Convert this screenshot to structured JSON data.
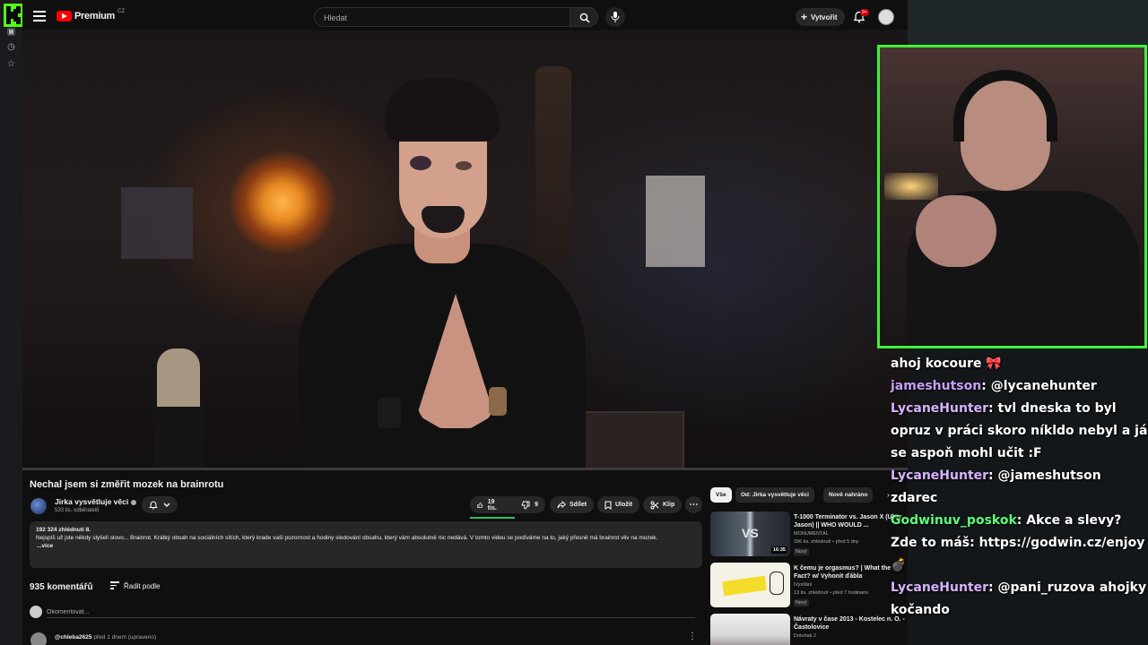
{
  "yt": {
    "logo_text": "Premium",
    "logo_region": "CZ",
    "search_placeholder": "Hledat",
    "create_label": "Vytvořit",
    "notifications_badge": "9+"
  },
  "video": {
    "title": "Nechal jsem si změřit mozek na brainrotu",
    "channel_name": "Jirka vysvětluje věci",
    "channel_subs": "533 tis. odběratelů",
    "likes": "19 tis.",
    "dislikes": "9",
    "share_label": "Sdílet",
    "save_label": "Uložit",
    "clip_label": "Klip",
    "description_stats": "192 324 zhlédnutí  8.",
    "description_text": "Nejspíš už jste někdy slyšeli slovo... Brainrot. Krátký obsah na sociálních sítích, který krade vaši pozornost a hodiny sledování obsahu, který vám absolutně nic nedává. V tomto videu se podíváme na to, jaký přesně má brainrot vliv na mozek.",
    "description_more": "...více"
  },
  "comments": {
    "count": "935 komentářů",
    "sort_label": "Řadit podle",
    "add_placeholder": "Okomentovat...",
    "first": {
      "author": "@chleba2625",
      "time": "před 1 dnem (upraveno)"
    }
  },
  "chips": [
    {
      "label": "Vše",
      "active": true
    },
    {
      "label": "Od: Jirka vysvětluje věci",
      "active": false
    },
    {
      "label": "Nově nahráno",
      "active": false
    }
  ],
  "recommendations": [
    {
      "title": "T-1000 Terminator vs. Jason X (Uber Jason) || WHO WOULD ...",
      "channel": "MONUMENTAL",
      "meta": "396 tis. zhlédnutí • před 5 dny",
      "badge": "Nový",
      "duration": "16:35"
    },
    {
      "title": "K čemu je orgasmus? | What the Fact? w/ Vyhonit ďábla",
      "channel": "iVysílání",
      "meta": "13 tis. zhlédnutí • před 7 hodinami",
      "badge": "Nový",
      "duration": ""
    },
    {
      "title": "Návraty v čase  2013 - Kostelec n. O. - Častolovice",
      "channel": "Dotuhak 2",
      "meta": "",
      "badge": "",
      "duration": ""
    }
  ],
  "chat": [
    {
      "user": "",
      "user_color": "#ffffff",
      "text": "ahoj kocoure 🎀"
    },
    {
      "user": "jameshutson",
      "user_color": "#c79ff7",
      "text": ": @lycanehunter"
    },
    {
      "user": "LycaneHunter",
      "user_color": "#d9b3ff",
      "text": ": tvl dneska to byl opruz v práci skoro níkldo nebyl a já se aspoň mohl učit :F"
    },
    {
      "user": "LycaneHunter",
      "user_color": "#d9b3ff",
      "text": ": @jameshutson zdarec"
    },
    {
      "user": "Godwinuv_poskok",
      "user_color": "#5cff7a",
      "text": ": Akce a slevy? Zde to máš: https://godwin.cz/enjoy 💣"
    },
    {
      "user": "LycaneHunter",
      "user_color": "#d9b3ff",
      "text": ": @pani_ruzova ahojky kočando"
    }
  ],
  "colors": {
    "kick_green": "#53fc18",
    "yt_red": "#ff0000",
    "cam_border": "#3ff23a"
  }
}
